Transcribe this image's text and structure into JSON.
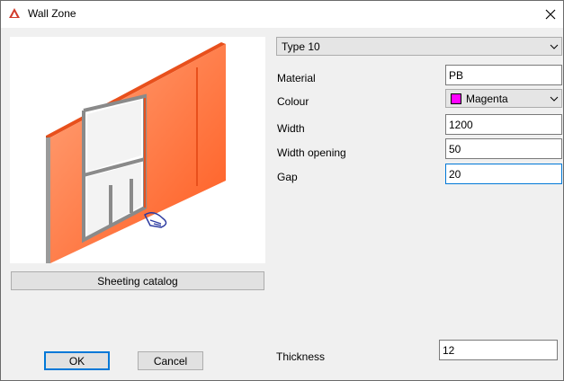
{
  "window": {
    "title": "Wall Zone"
  },
  "type_select": {
    "value": "Type 10"
  },
  "fields": {
    "material": {
      "label": "Material",
      "value": "PB"
    },
    "colour": {
      "label": "Colour",
      "value": "Magenta",
      "swatch_color": "#ff00ff"
    },
    "width": {
      "label": "Width",
      "value": "1200"
    },
    "width_opening": {
      "label": "Width opening",
      "value": "50"
    },
    "gap": {
      "label": "Gap",
      "value": "20"
    },
    "thickness": {
      "label": "Thickness",
      "value": "12"
    }
  },
  "buttons": {
    "sheeting_catalog": "Sheeting catalog",
    "ok": "OK",
    "cancel": "Cancel"
  },
  "colors": {
    "accent": "#0078d7",
    "panel": "#ff7a45"
  },
  "icons": {
    "app": "app-logo-icon",
    "close": "close-icon",
    "combo_arrow": "chevron-down-icon"
  }
}
